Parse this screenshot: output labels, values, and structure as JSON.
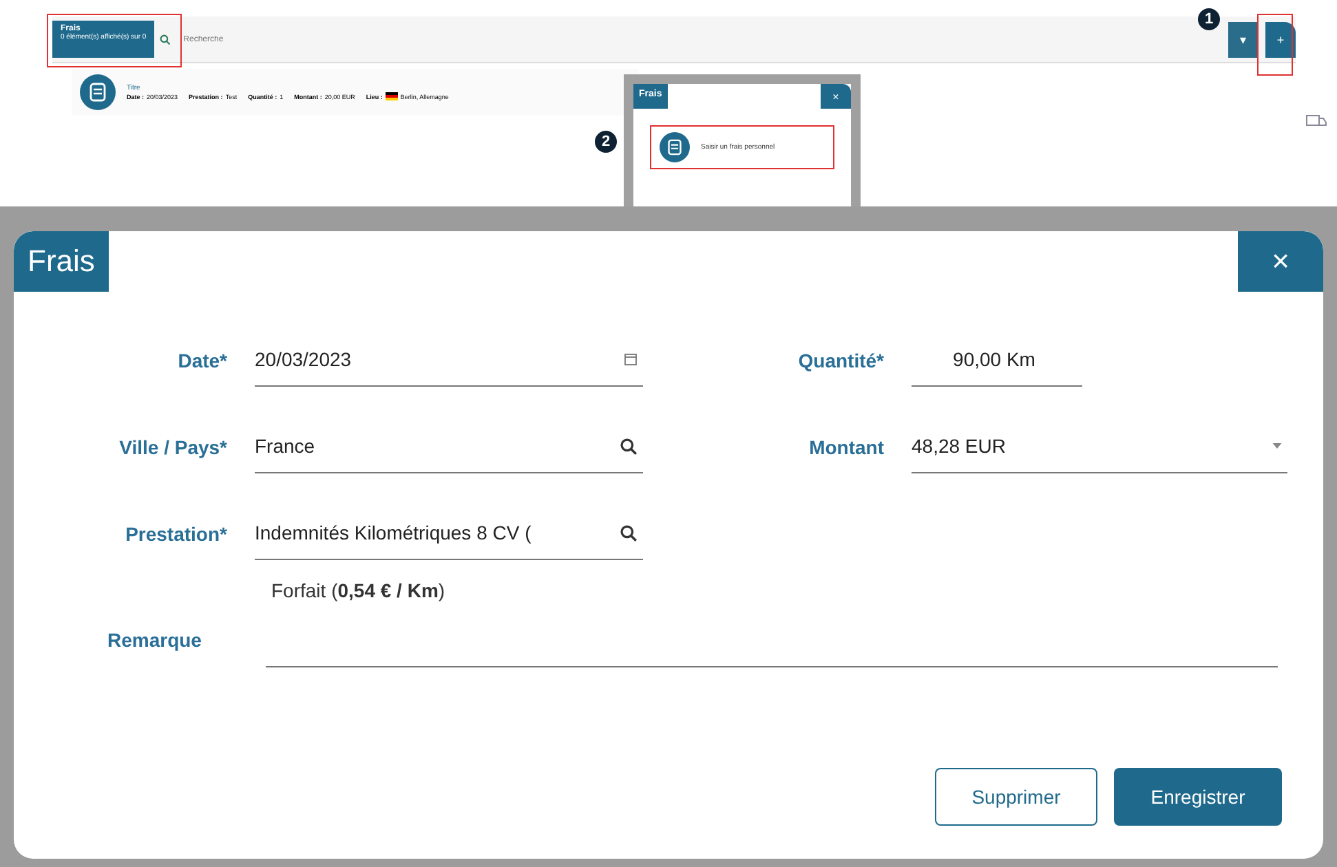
{
  "top_bar": {
    "tag_title": "Frais",
    "tag_subtitle": "0 élément(s) affiché(s) sur 0",
    "search_placeholder": "Recherche",
    "buttons": [
      {
        "label": "▾",
        "kind": "dropdown"
      },
      {
        "label": "+",
        "kind": "add"
      }
    ]
  },
  "list_item": {
    "title": "Titre",
    "details": [
      {
        "label": "Date :",
        "value": "20/03/2023"
      },
      {
        "label": "Prestation :",
        "value": "Test"
      },
      {
        "label": "Quantité :",
        "value": "1"
      },
      {
        "label": "Montant :",
        "value": "20,00 EUR"
      },
      {
        "label": "Lieu :",
        "value": "Berlin, Allemagne",
        "flag": true
      }
    ]
  },
  "callouts": [
    "1",
    "2"
  ],
  "popup": {
    "title": "Frais",
    "close": "×",
    "item": "Saisir un frais personnel"
  },
  "dialog": {
    "title": "Frais",
    "close": "×",
    "fields": [
      {
        "label": "Date*",
        "value": "20/03/2023",
        "kind": "date"
      },
      {
        "label": "Quantité*",
        "value": "90,00 Km",
        "kind": "number"
      },
      {
        "label": "Ville / Pays*",
        "value": "France",
        "kind": "search"
      },
      {
        "label": "Montant",
        "value": "48,28  EUR",
        "kind": "select"
      },
      {
        "label": "Prestation*",
        "value": "Indemnités Kilométriques 8 CV (",
        "kind": "search"
      }
    ],
    "forfait": "Forfait (**0,54 € / Km**)",
    "remark_label": "Remarque",
    "buttons": [
      {
        "label": "Supprimer",
        "kind": "secondary"
      },
      {
        "label": "Enregistrer",
        "kind": "primary"
      }
    ]
  }
}
